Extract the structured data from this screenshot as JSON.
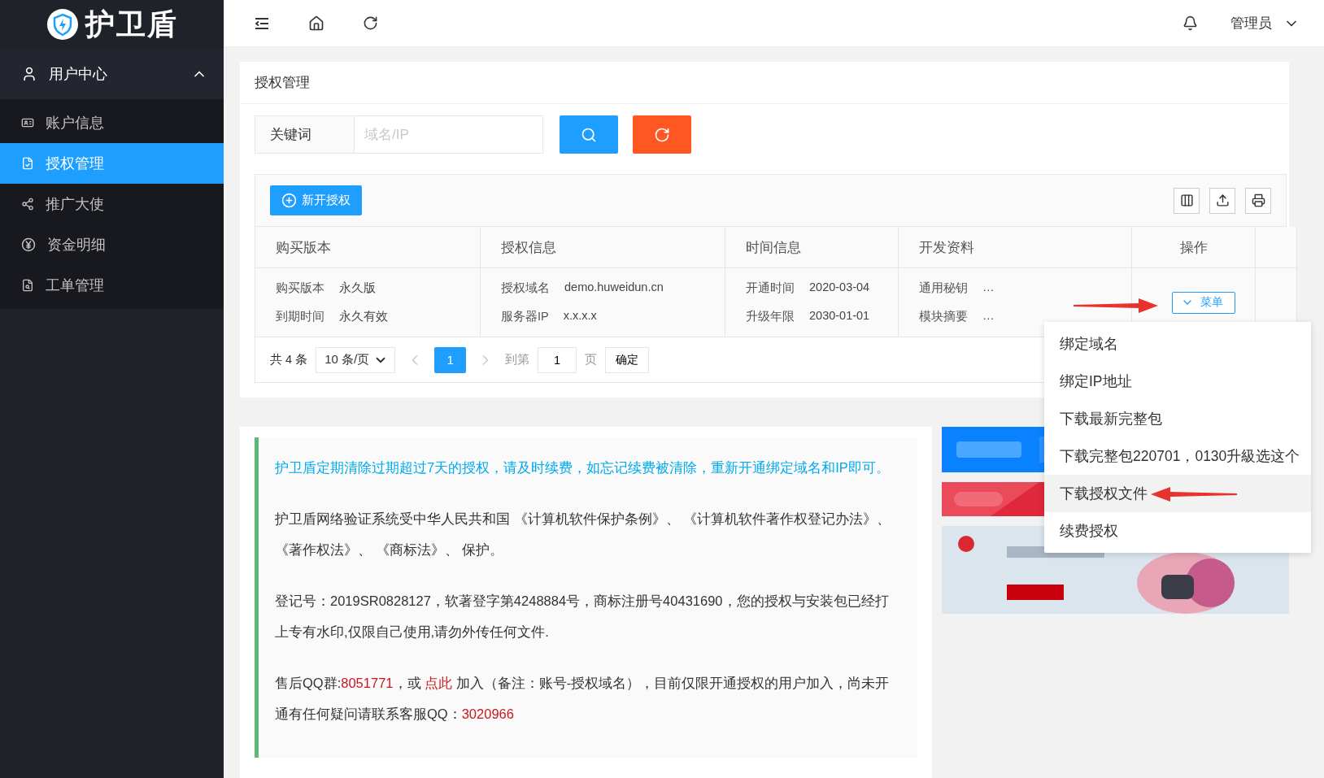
{
  "sidebar": {
    "logo": "护卫盾",
    "group": {
      "label": "用户中心",
      "expanded": true
    },
    "items": [
      {
        "label": "账户信息",
        "selected": false
      },
      {
        "label": "授权管理",
        "selected": true
      },
      {
        "label": "推广大使",
        "selected": false
      },
      {
        "label": "资金明细",
        "selected": false
      },
      {
        "label": "工单管理",
        "selected": false
      }
    ]
  },
  "header": {
    "user": "管理员"
  },
  "page": {
    "title": "授权管理",
    "search": {
      "label": "关键词",
      "placeholder": "域名/IP"
    }
  },
  "toolbar": {
    "new_button": "新开授权"
  },
  "table": {
    "columns": [
      "购买版本",
      "授权信息",
      "时间信息",
      "开发资料",
      "操作"
    ],
    "rows": [
      {
        "cells": [
          [
            {
              "label": "购买版本",
              "value": "永久版"
            },
            {
              "label": "到期时间",
              "value": "永久有效"
            }
          ],
          [
            {
              "label": "授权域名",
              "value": "demo.huweidun.cn"
            },
            {
              "label": "服务器IP",
              "value": "x.x.x.x"
            }
          ],
          [
            {
              "label": "开通时间",
              "value": "2020-03-04"
            },
            {
              "label": "升级年限",
              "value": "2030-01-01"
            }
          ],
          [
            {
              "label": "通用秘钥",
              "value": "…"
            },
            {
              "label": "模块摘要",
              "value": "…"
            }
          ]
        ],
        "action": "菜单"
      }
    ]
  },
  "pagination": {
    "total": "共 4 条",
    "page_size": "10 条/页",
    "pages": [
      {
        "label": "1",
        "selected": true
      }
    ],
    "goto_label": "到第",
    "goto_value": "1",
    "page_unit": "页",
    "confirm": "确定"
  },
  "action_menu": {
    "items": [
      {
        "label": "绑定域名",
        "selected": false
      },
      {
        "label": "绑定IP地址",
        "selected": false
      },
      {
        "label": "下载最新完整包",
        "selected": false
      },
      {
        "label": "下载完整包220701，0130升級选这个",
        "selected": false
      },
      {
        "label": "下载授权文件",
        "selected": true
      },
      {
        "label": "续费授权",
        "selected": false
      }
    ]
  },
  "notice": {
    "paragraphs": [
      {
        "kind": "highlight",
        "segments": [
          {
            "kind": "text",
            "text": "护卫盾定期清除过期超过7天的授权，请及时续费，如忘记续费被清除，重新开通绑定域名和IP即可。"
          }
        ]
      },
      {
        "kind": "plain",
        "segments": [
          {
            "kind": "text",
            "text": "护卫盾网络验证系统受中华人民共和国 《计算机软件保护条例》、 《计算机软件著作权登记办法》、《著作权法》、 《商标法》、 保护。"
          }
        ]
      },
      {
        "kind": "plain",
        "segments": [
          {
            "kind": "text",
            "text": "登记号：2019SR0828127，软著登字第4248884号，商标注册号40431690，您的授权与安装包已经打上专有水印,仅限自己使用,请勿外传任何文件."
          }
        ]
      },
      {
        "kind": "plain",
        "segments": [
          {
            "kind": "text",
            "text": "售后QQ群:"
          },
          {
            "kind": "number",
            "text": "8051771"
          },
          {
            "kind": "text",
            "text": "，或 "
          },
          {
            "kind": "link",
            "text": "点此"
          },
          {
            "kind": "text",
            "text": " 加入（备注：账号-授权域名），目前仅限开通授权的用户加入，尚未开通有任何疑问请联系客服QQ："
          },
          {
            "kind": "number",
            "text": "3020966"
          }
        ]
      }
    ]
  }
}
